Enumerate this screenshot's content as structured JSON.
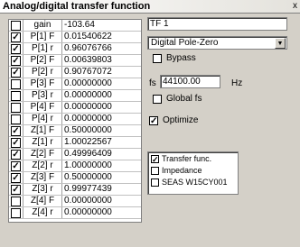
{
  "window": {
    "title": "Analog/digital transfer function",
    "close_glyph": "x"
  },
  "params": [
    {
      "label": "gain",
      "value": "-103.64",
      "checked": false
    },
    {
      "label": "P[1] F",
      "value": "0.01540622",
      "checked": true
    },
    {
      "label": "P[1] r",
      "value": "0.96076766",
      "checked": true
    },
    {
      "label": "P[2] F",
      "value": "0.00639803",
      "checked": true
    },
    {
      "label": "P[2] r",
      "value": "0.90767072",
      "checked": true
    },
    {
      "label": "P[3] F",
      "value": "0.00000000",
      "checked": false
    },
    {
      "label": "P[3] r",
      "value": "0.00000000",
      "checked": false
    },
    {
      "label": "P[4] F",
      "value": "0.00000000",
      "checked": false
    },
    {
      "label": "P[4] r",
      "value": "0.00000000",
      "checked": false
    },
    {
      "label": "Z[1] F",
      "value": "0.50000000",
      "checked": true
    },
    {
      "label": "Z[1] r",
      "value": "1.00022567",
      "checked": true
    },
    {
      "label": "Z[2] F",
      "value": "0.49996409",
      "checked": true
    },
    {
      "label": "Z[2] r",
      "value": "1.00000000",
      "checked": true
    },
    {
      "label": "Z[3] F",
      "value": "0.50000000",
      "checked": true
    },
    {
      "label": "Z[3] r",
      "value": "0.99977439",
      "checked": true
    },
    {
      "label": "Z[4] F",
      "value": "0.00000000",
      "checked": false
    },
    {
      "label": "Z[4] r",
      "value": "0.00000000",
      "checked": false
    }
  ],
  "name_field": {
    "value": "TF 1"
  },
  "type_select": {
    "value": "Digital Pole-Zero"
  },
  "bypass": {
    "label": "Bypass",
    "checked": false
  },
  "fs": {
    "label": "fs",
    "value": "44100.00",
    "unit": "Hz"
  },
  "global_fs": {
    "label": "Global fs",
    "checked": false
  },
  "optimize": {
    "label": "Optimize",
    "checked": true
  },
  "targets": [
    {
      "label": "Transfer func.",
      "checked": true
    },
    {
      "label": "Impedance",
      "checked": false
    },
    {
      "label": "SEAS W15CY001",
      "checked": false
    }
  ],
  "check_glyph": "✓"
}
